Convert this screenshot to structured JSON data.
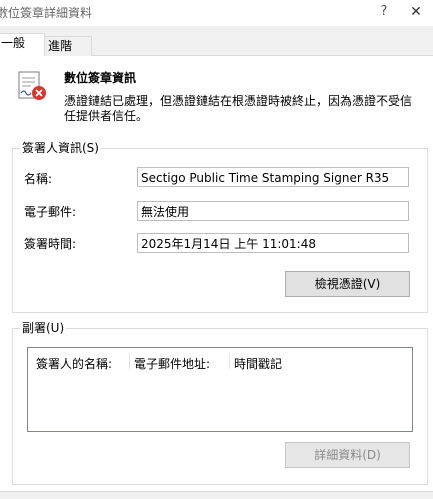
{
  "window": {
    "title": "數位簽章詳細資料",
    "help_label": "?",
    "close_label": "✕"
  },
  "tabs": [
    {
      "label": "一般",
      "active": true
    },
    {
      "label": "進階",
      "active": false
    }
  ],
  "info": {
    "icon": "certificate-error-icon",
    "title": "數位簽章資訊",
    "line1": "憑證鏈結已處理，但憑證鏈結在根憑證時被終止，因為憑證不受信",
    "line2": "任提供者信任。"
  },
  "signer": {
    "legend": "簽署人資訊(S)",
    "name_label": "名稱:",
    "name_value": "Sectigo Public Time Stamping Signer R35",
    "email_label": "電子郵件:",
    "email_value": "無法使用",
    "time_label": "簽署時間:",
    "time_value": "2025年1月14日 上午 11:01:48",
    "view_cert_label": "檢視憑證(V)"
  },
  "countersign": {
    "legend": "副署(U)",
    "columns": [
      "簽署人的名稱:",
      "電子郵件地址:",
      "時間戳記"
    ],
    "rows": [],
    "details_label": "詳細資料(D)"
  },
  "colors": {
    "error_badge": "#d9342b",
    "panel_bg": "#ffffff",
    "window_bg": "#f0f0f0"
  }
}
